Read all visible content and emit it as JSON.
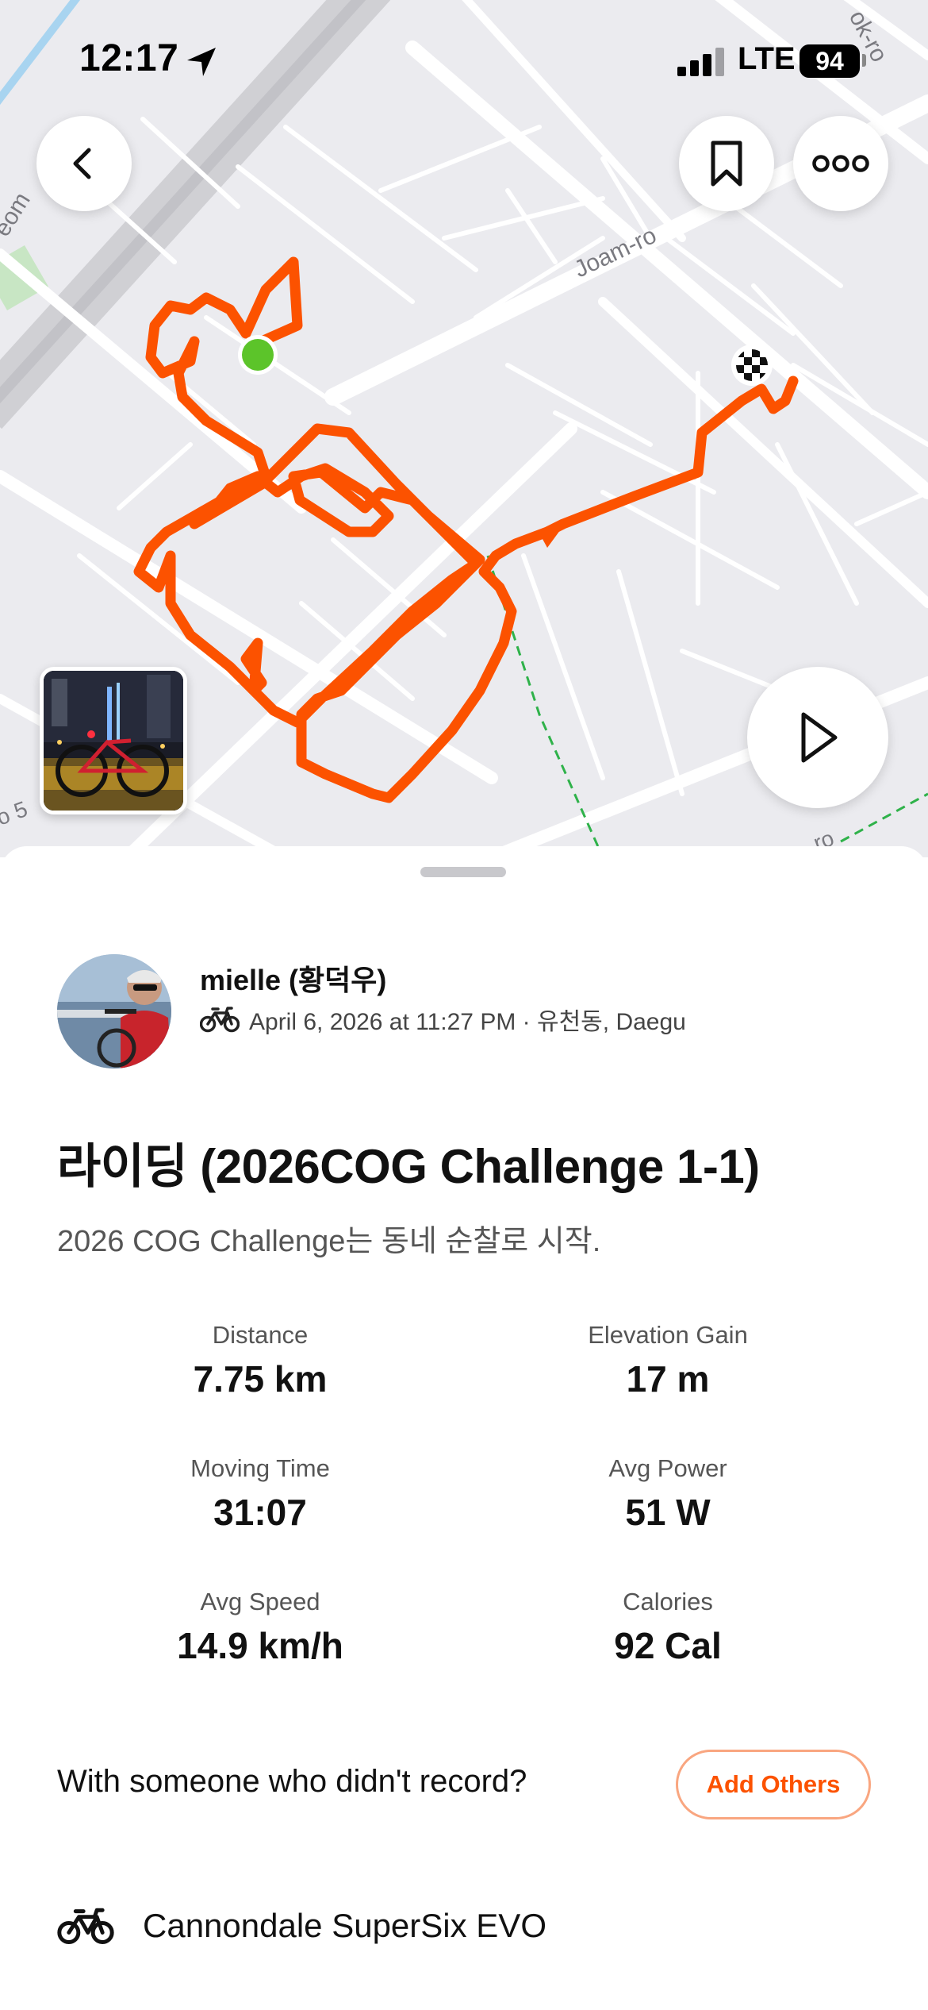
{
  "status_bar": {
    "time": "12:17",
    "carrier": "LTE",
    "battery": "94"
  },
  "map": {
    "street_labels": [
      "Joam-ro",
      "eom",
      "ok-ro",
      "o 5",
      "ro"
    ],
    "route_color": "#fc5200",
    "start_marker_color": "#5cc42a"
  },
  "toolbar": {
    "back_icon": "chevron-left-icon",
    "save_icon": "bookmark-icon",
    "more_icon": "more-dots-icon",
    "play_icon": "play-icon"
  },
  "activity": {
    "athlete_name": "mielle (황덕우)",
    "meta": "April 6, 2026 at 11:27 PM · 유천동, Daegu",
    "sport_icon": "bike-icon",
    "title": "라이딩 (2026COG Challenge 1-1)",
    "description": "2026 COG Challenge는 동네 순찰로 시작."
  },
  "stats": [
    {
      "label": "Distance",
      "value": "7.75 km"
    },
    {
      "label": "Elevation Gain",
      "value": "17 m"
    },
    {
      "label": "Moving Time",
      "value": "31:07"
    },
    {
      "label": "Avg Power",
      "value": "51 W"
    },
    {
      "label": "Avg Speed",
      "value": "14.9 km/h"
    },
    {
      "label": "Calories",
      "value": "92 Cal"
    }
  ],
  "with_others": {
    "prompt": "With someone who didn't record?",
    "button_label": "Add Others"
  },
  "gear": {
    "name": "Cannondale SuperSix EVO",
    "icon": "bike-icon"
  },
  "colors": {
    "accent": "#fc5200",
    "accent_border": "#f9a680"
  }
}
